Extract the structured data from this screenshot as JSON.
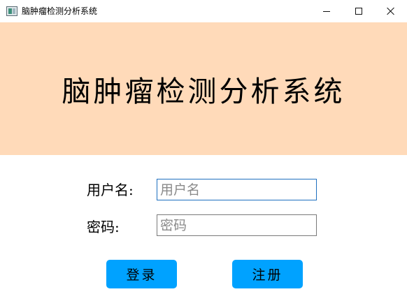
{
  "window": {
    "title": "脑肿瘤检测分析系统",
    "controls": [
      "minimize-icon",
      "maximize-icon",
      "close-icon"
    ]
  },
  "banner": {
    "title": "脑肿瘤检测分析系统",
    "background": "#ffdab9"
  },
  "form": {
    "username_label": "用户名:",
    "username_placeholder": "用户名",
    "username_value": "",
    "password_label": "密码:",
    "password_placeholder": "密码",
    "password_value": ""
  },
  "actions": {
    "login_label": "登录",
    "register_label": "注册",
    "button_color": "#00a2ff"
  }
}
